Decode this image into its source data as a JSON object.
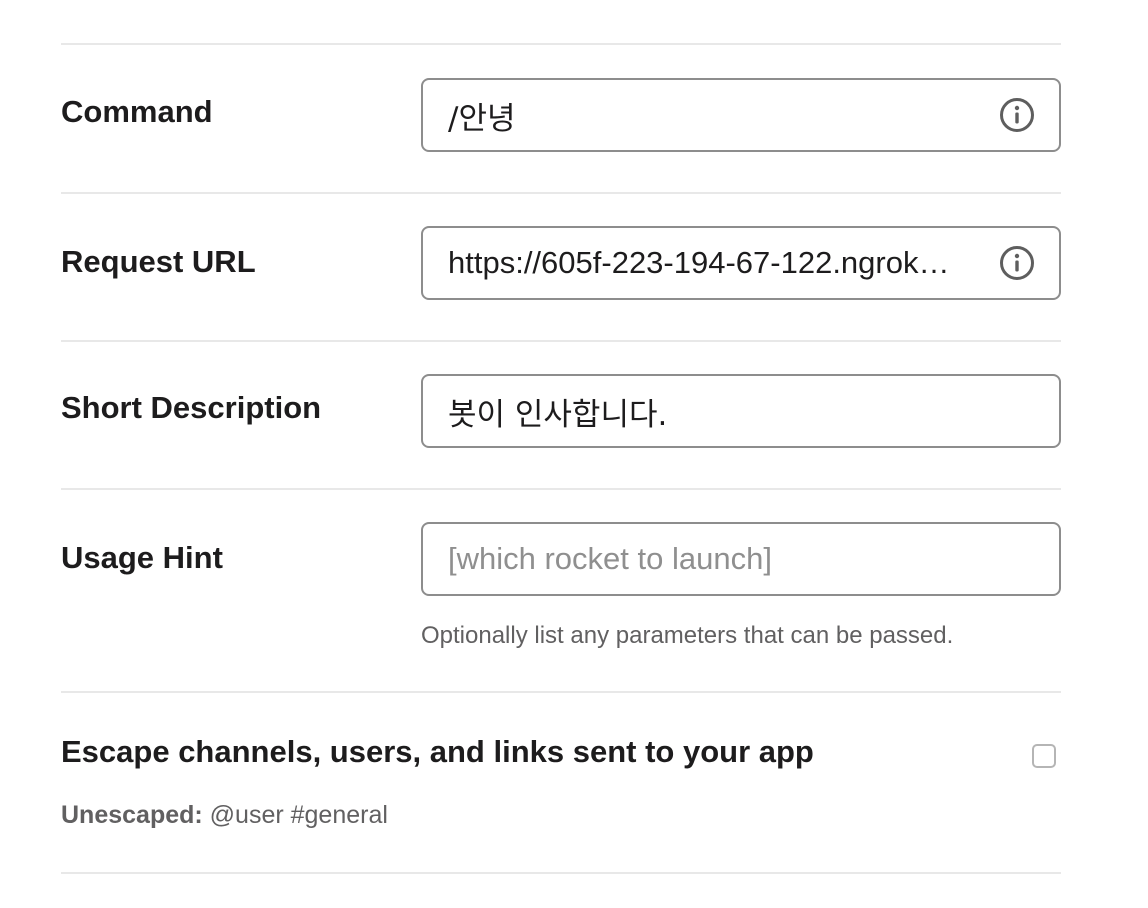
{
  "form": {
    "command": {
      "label": "Command",
      "value": "/안녕",
      "icon": "info-icon"
    },
    "request_url": {
      "label": "Request URL",
      "value": "https://605f-223-194-67-122.ngrok…",
      "icon": "info-icon"
    },
    "short_description": {
      "label": "Short Description",
      "value": "봇이 인사합니다."
    },
    "usage_hint": {
      "label": "Usage Hint",
      "placeholder": "[which rocket to launch]",
      "help": "Optionally list any parameters that can be passed."
    },
    "escape": {
      "label": "Escape channels, users, and links sent to your app",
      "checked": false,
      "note_label": "Unescaped:",
      "note_value": "@user #general"
    }
  },
  "colors": {
    "text": "#1d1c1d",
    "muted": "#616061",
    "border": "#8d8d8d",
    "divider": "#e8e8e8",
    "placeholder": "#8f8f8f"
  }
}
